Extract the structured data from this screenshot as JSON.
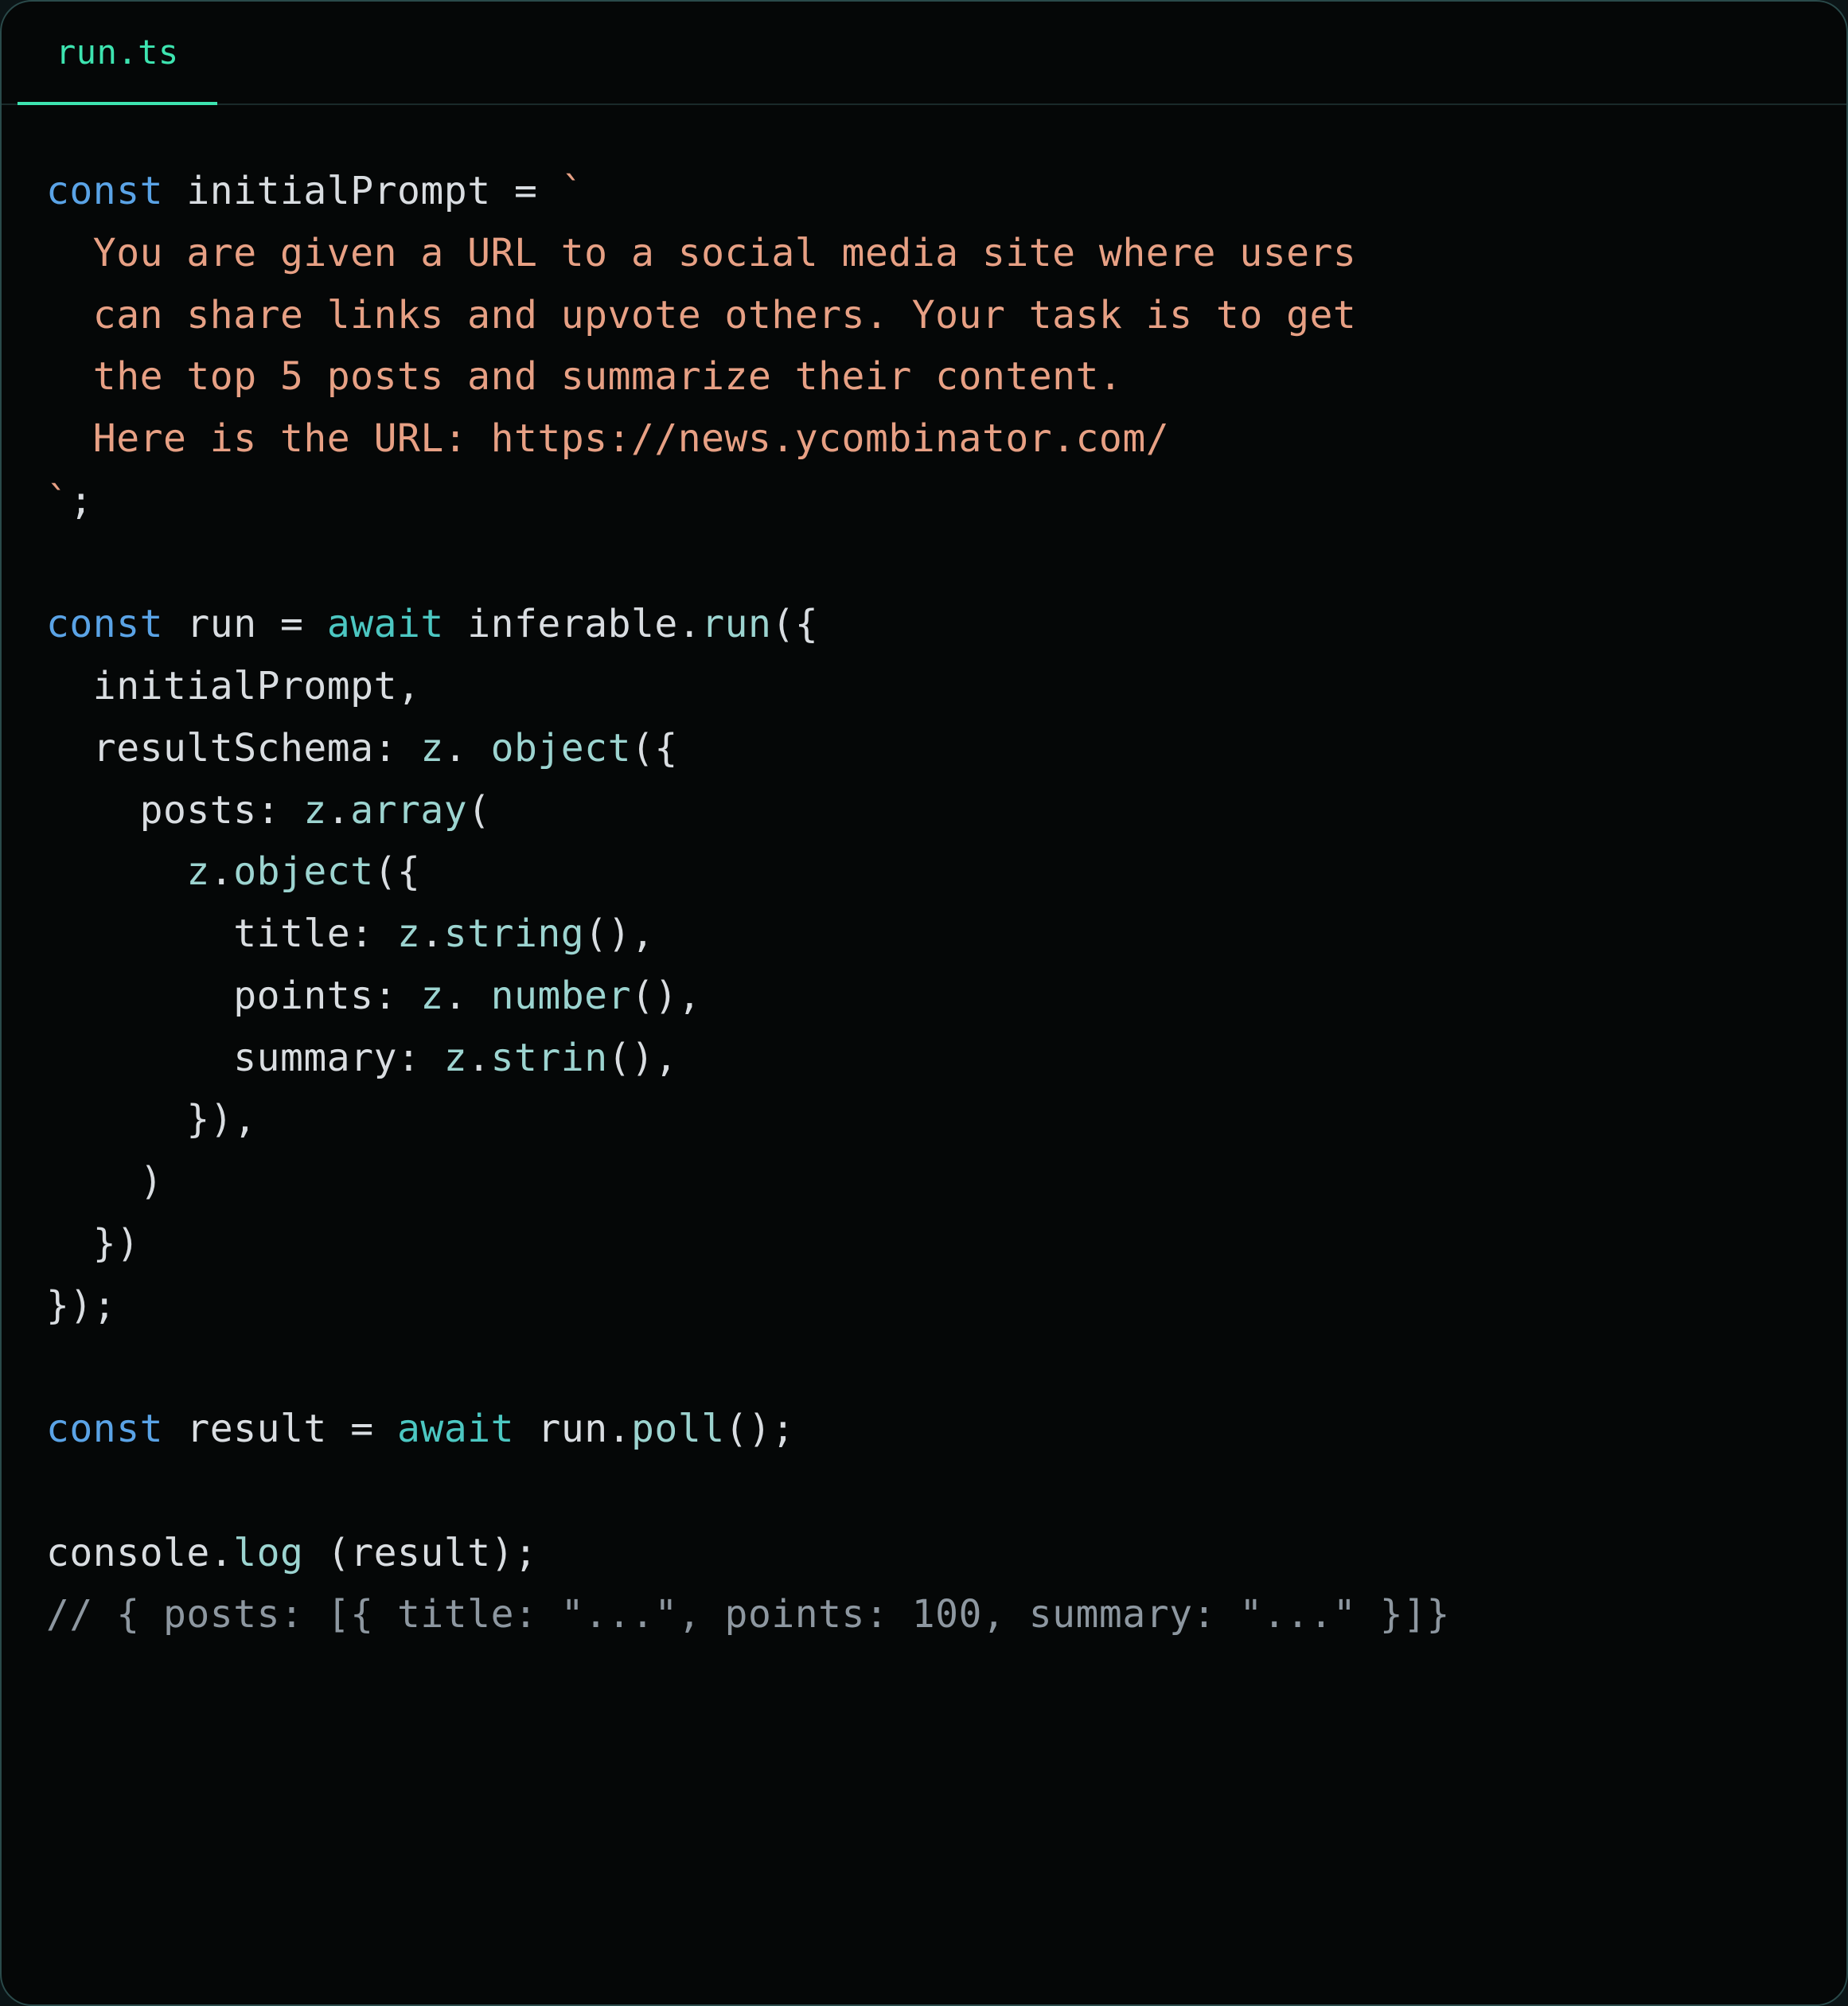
{
  "tab": {
    "name": "run.ts"
  },
  "code": {
    "l1_const": "const",
    "l1_ident": "initialPrompt",
    "l1_eq": "=",
    "l1_tick": "`",
    "l2": "  You are given a URL to a social media site where users",
    "l3": "  can share links and upvote others. Your task is to get",
    "l4": "  the top 5 posts and summarize their content.",
    "l5": "  Here is the URL: https://news.ycombinator.com/",
    "l6_tick": "`",
    "l6_semi": ";",
    "l8_const": "const",
    "l8_run": "run",
    "l8_eq": "=",
    "l8_await": "await",
    "l8_inferable": "inferable",
    "l8_dot": ".",
    "l8_runfn": "run",
    "l8_tail": "({",
    "l9": "  initialPrompt,",
    "l10_lead": "  resultSchema: ",
    "l10_z": "z",
    "l10_dot": ". ",
    "l10_obj": "object",
    "l10_tail": "({",
    "l11_lead": "    posts: ",
    "l11_z": "z",
    "l11_dot": ".",
    "l11_arr": "array",
    "l11_tail": "(",
    "l12_lead": "      ",
    "l12_z": "z",
    "l12_dot": ".",
    "l12_obj": "object",
    "l12_tail": "({",
    "l13_lead": "        title: ",
    "l13_z": "z",
    "l13_dot": ".",
    "l13_str": "string",
    "l13_tail": "(),",
    "l14_lead": "        points: ",
    "l14_z": "z",
    "l14_dot": ". ",
    "l14_num": "number",
    "l14_tail": "(),",
    "l15_lead": "        summary: ",
    "l15_z": "z",
    "l15_dot": ".",
    "l15_strin": "strin",
    "l15_tail": "(),",
    "l16": "      }),",
    "l17": "    )",
    "l18": "  })",
    "l19": "});",
    "l21_const": "const",
    "l21_result": "result",
    "l21_eq": "=",
    "l21_await": "await",
    "l21_run": "run",
    "l21_dot": ".",
    "l21_poll": "poll",
    "l21_tail": "();",
    "l23_console": "console",
    "l23_dot": ".",
    "l23_log": "log",
    "l23_sp": " ",
    "l23_open": "(",
    "l23_result": "result",
    "l23_close": ");",
    "l24": "// { posts: [{ title: \"...\", points: 100, summary: \"...\" }]}"
  }
}
